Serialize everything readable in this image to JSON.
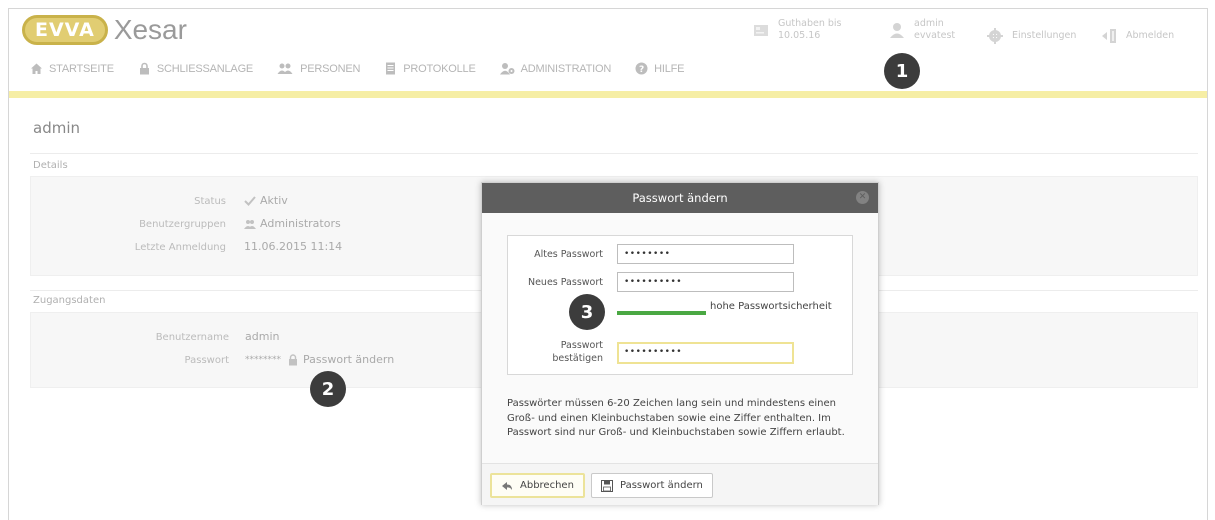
{
  "header": {
    "logo_badge": "EVVA",
    "logo_text": "Xesar",
    "credit_label": "Guthaben bis",
    "credit_date": "10.05.16",
    "user_name": "admin",
    "user_org": "evvatest",
    "settings_label": "Einstellungen",
    "logout_label": "Abmelden"
  },
  "nav": {
    "items": [
      {
        "label": "STARTSEITE",
        "icon": "home-icon"
      },
      {
        "label": "SCHLIESSANLAGE",
        "icon": "lock-icon"
      },
      {
        "label": "PERSONEN",
        "icon": "people-icon"
      },
      {
        "label": "PROTOKOLLE",
        "icon": "document-icon"
      },
      {
        "label": "ADMINISTRATION",
        "icon": "admin-icon"
      },
      {
        "label": "HILFE",
        "icon": "help-icon"
      }
    ]
  },
  "page": {
    "title": "admin",
    "details_label": "Details",
    "status_label": "Status",
    "status_value": "Aktiv",
    "groups_label": "Benutzergruppen",
    "groups_value": "Administrators",
    "last_login_label": "Letzte Anmeldung",
    "last_login_value": "11.06.2015 11:14",
    "access_label": "Zugangsdaten",
    "username_label": "Benutzername",
    "username_value": "admin",
    "password_label": "Passwort",
    "password_value": "********",
    "change_password_link": "Passwort ändern"
  },
  "markers": [
    "1",
    "2",
    "3"
  ],
  "dialog": {
    "title": "Passwort ändern",
    "old_password_label": "Altes Passwort",
    "old_password_value": "••••••••",
    "new_password_label": "Neues Passwort",
    "new_password_value": "••••••••••",
    "strength_text": "hohe Passwortsicherheit",
    "strength_level": 1.0,
    "strength_color": "#4aa843",
    "confirm_label": "Passwort bestätigen",
    "confirm_value": "••••••••••",
    "info": "Passwörter müssen 6-20 Zeichen lang sein und mindestens einen Groß- und einen Kleinbuchstaben sowie eine Ziffer enthalten. Im Passwort sind nur Groß- und Kleinbuchstaben sowie Ziffern erlaubt.",
    "cancel_label": "Abbrechen",
    "submit_label": "Passwort ändern"
  },
  "colors": {
    "accent_yellow": "#f6eea5",
    "dialog_header": "#5e5e5e",
    "marker": "#3c3c3c"
  }
}
